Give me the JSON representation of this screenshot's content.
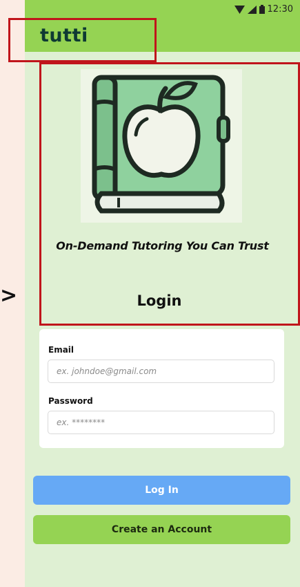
{
  "status_bar": {
    "time": "12:30"
  },
  "app_bar": {
    "title": "tutti"
  },
  "annotation": {
    "arrow": ">"
  },
  "hero": {
    "tagline": "On-Demand Tutoring You Can Trust",
    "heading": "Login"
  },
  "form": {
    "email_label": "Email",
    "email_placeholder": "ex. johndoe@gmail.com",
    "email_value": "",
    "password_label": "Password",
    "password_placeholder": "ex. ********",
    "password_value": ""
  },
  "buttons": {
    "login": "Log In",
    "create_account": "Create an Account"
  },
  "colors": {
    "app_bar": "#95d353",
    "screen_bg": "#dff0d3",
    "login_button": "#66a9f5",
    "create_button": "#95d353",
    "highlight_box": "#c0151b"
  },
  "icons": [
    "wifi-icon",
    "signal-icon",
    "battery-icon",
    "apple-book-logo"
  ]
}
